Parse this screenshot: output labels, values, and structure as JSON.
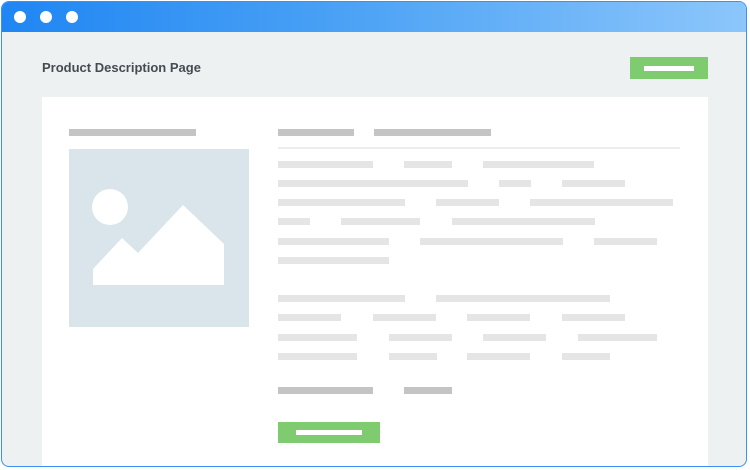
{
  "window": {
    "title_bar_buttons": [
      "close",
      "minimize",
      "maximize"
    ],
    "accent_color": "#1f86f3"
  },
  "header": {
    "title": "Product Description Page",
    "action_button": {
      "label": "",
      "icon": "text-placeholder"
    }
  },
  "product": {
    "image_icon": "image-placeholder-icon",
    "buy_button": {
      "label": "",
      "icon": "text-placeholder"
    }
  },
  "colors": {
    "button_green": "#7fcc70",
    "placeholder_bar": "#e5e5e5",
    "placeholder_bar_dark": "#c4c4c4",
    "image_placeholder": "#d9e5ea",
    "background": "#eef1f2"
  }
}
